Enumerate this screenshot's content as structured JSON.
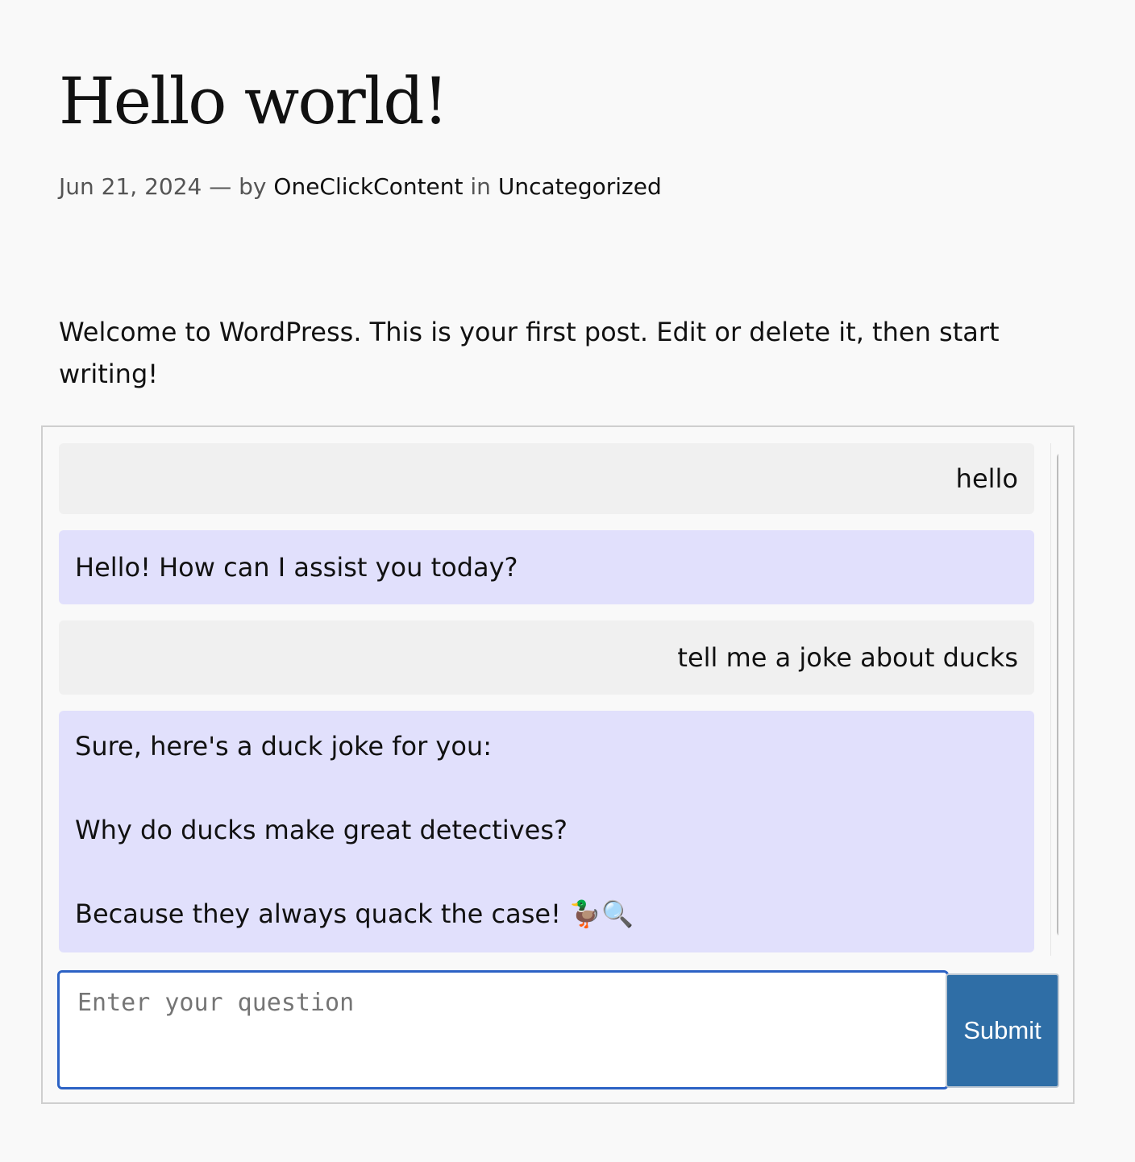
{
  "post": {
    "title": "Hello world!",
    "date": "Jun 21, 2024",
    "by_separator": "— by",
    "author": "OneClickContent",
    "in_separator": "in",
    "category": "Uncategorized",
    "body": "Welcome to WordPress. This is your first post. Edit or delete it, then start writing!"
  },
  "chat": {
    "messages": [
      {
        "role": "user",
        "text": "hello"
      },
      {
        "role": "bot",
        "text": "Hello! How can I assist you today?"
      },
      {
        "role": "user",
        "text": "tell me a joke about ducks"
      },
      {
        "role": "bot",
        "paragraphs": [
          "Sure, here's a duck joke for you:",
          "Why do ducks make great detectives?",
          "Because they always quack the case! 🦆🔍"
        ]
      }
    ],
    "input": {
      "placeholder": "Enter your question",
      "value": ""
    },
    "submit_label": "Submit",
    "colors": {
      "user_bubble": "#f0f0f0",
      "bot_bubble": "#e1e0fc",
      "submit_bg": "#2f6ea6",
      "input_focus": "#2c62c5"
    }
  }
}
